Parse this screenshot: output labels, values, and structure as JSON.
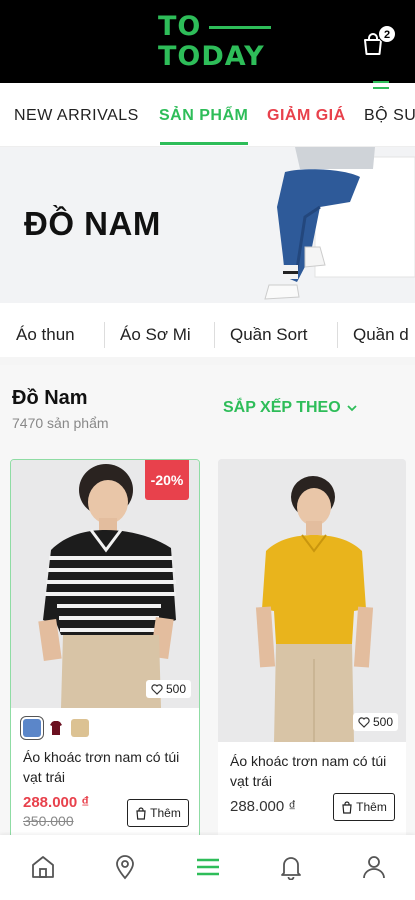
{
  "header": {
    "logo_line1": "TO",
    "logo_line2": "TODAY",
    "cart_count": "2",
    "accent_color": "#2ebd59"
  },
  "tabs": [
    {
      "label": "NEW ARRIVALS",
      "active": false
    },
    {
      "label": "SẢN PHẨM",
      "active": true
    },
    {
      "label": "GIẢM GIÁ",
      "active": false
    },
    {
      "label": "BỘ SU",
      "active": false
    }
  ],
  "banner": {
    "title": "ĐỒ NAM"
  },
  "subcategories": [
    "Áo thun",
    "Áo Sơ Mi",
    "Quần Sort",
    "Quần d"
  ],
  "section": {
    "title": "Đồ Nam",
    "count": "7470 sản phẩm",
    "sort_label": "SẮP XẾP THEO"
  },
  "products": [
    {
      "discount": "-20%",
      "likes": "500",
      "colors": [
        "#5b86c9",
        "#6b1020",
        "#dcc293"
      ],
      "name": "Áo khoác trơn nam có túi vạt trái",
      "price": "288.000 ₫",
      "old_price": "350.000",
      "add_label": "Thêm"
    },
    {
      "likes": "500",
      "name": "Áo khoác trơn nam có túi vạt trái",
      "price": "288.000 ₫",
      "add_label": "Thêm"
    }
  ],
  "bottom_nav": [
    "home-icon",
    "location-icon",
    "menu-icon",
    "bell-icon",
    "user-icon"
  ]
}
